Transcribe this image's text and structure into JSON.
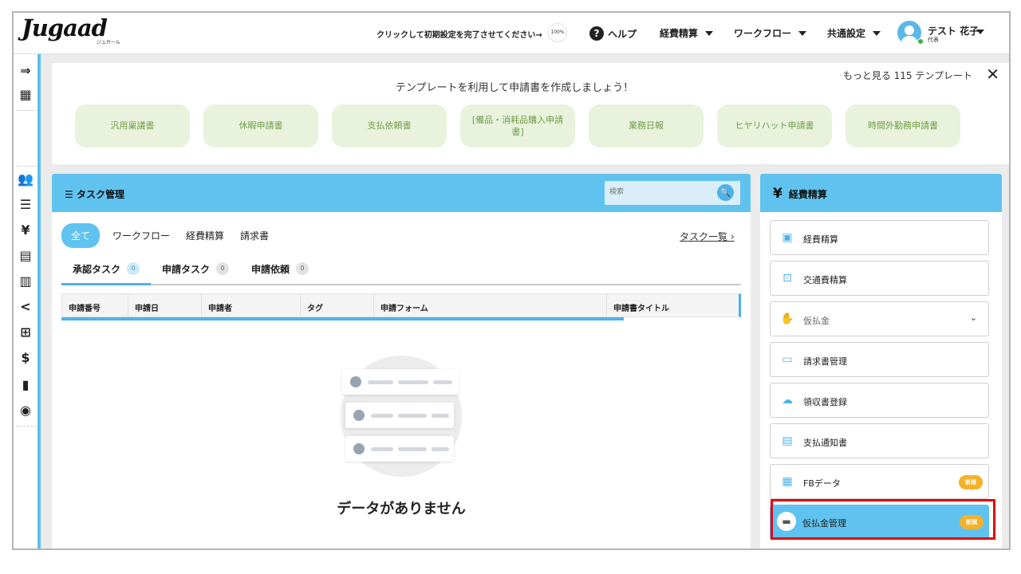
{
  "header": {
    "logo": "Jugaad",
    "logo_sub": "ジュガール",
    "setup_text": "クリックして初期設定を完了させてください→",
    "setup_progress": "100%",
    "help_icon": "question-circle-icon",
    "help": "ヘルプ",
    "nav": [
      "経費精算",
      "ワークフロー",
      "共通設定"
    ],
    "user_name": "テスト 花子",
    "user_role": "代表"
  },
  "sidebar": {
    "icons": [
      "expand-menu-icon",
      "building-icon",
      "users-icon",
      "list-icon",
      "yen-icon",
      "document-icon",
      "receipt-icon",
      "share-icon",
      "grid-icon",
      "invoice-icon",
      "book-icon",
      "palette-icon"
    ]
  },
  "templates": {
    "title": "テンプレートを利用して申請書を作成しましょう！",
    "more": "もっと見る 115 テンプレート",
    "items": [
      "汎用稟議書",
      "休暇申請書",
      "支払依頼書",
      "[備品・消耗品購入申請書]",
      "業務日報",
      "ヒヤリハット申請書",
      "時間外勤務申請書"
    ]
  },
  "tasks": {
    "title": "タスク管理",
    "search_placeholder": "検索",
    "filters": [
      "全て",
      "ワークフロー",
      "経費精算",
      "請求書"
    ],
    "list_link": "タスク一覧",
    "tabs": [
      {
        "label": "承認タスク",
        "count": "0"
      },
      {
        "label": "申請タスク",
        "count": "0"
      },
      {
        "label": "申請依頼",
        "count": "0"
      }
    ],
    "columns": [
      "申請番号",
      "申請日",
      "申請者",
      "タグ",
      "申請フォーム",
      "申請書タイトル"
    ],
    "empty": "データがありません"
  },
  "expense": {
    "title": "経費精算",
    "items": [
      {
        "label": "経費精算",
        "icon": "money-icon"
      },
      {
        "label": "交通費精算",
        "icon": "train-icon"
      },
      {
        "label": "仮払金",
        "icon": "hand-coin-icon"
      },
      {
        "label": "請求書管理",
        "icon": "card-icon"
      },
      {
        "label": "領収書登録",
        "icon": "cloud-upload-icon"
      },
      {
        "label": "支払通知書",
        "icon": "notice-icon"
      },
      {
        "label": "FBデータ",
        "icon": "fb-data-icon",
        "badge": "新規"
      },
      {
        "label": "仮払金管理",
        "icon": "wallet-icon",
        "badge": "新規"
      }
    ]
  },
  "colors": {
    "accent": "#60c3ef",
    "template_bg": "#e8f2dc",
    "template_text": "#6f9f48",
    "badge": "#f3b22a",
    "highlight": "#e60012"
  }
}
